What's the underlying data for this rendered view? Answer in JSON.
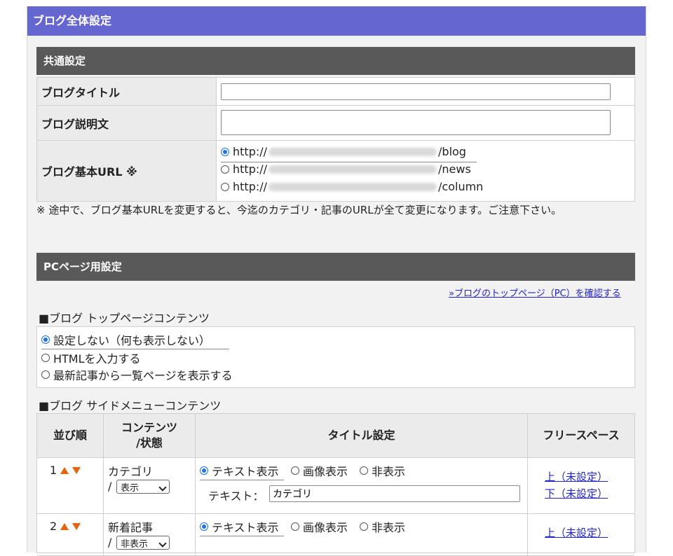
{
  "header": {
    "title": "ブログ全体設定"
  },
  "common": {
    "heading": "共通設定",
    "title_label": "ブログタイトル",
    "title_value": "",
    "description_label": "ブログ説明文",
    "description_value": "",
    "url_label": "ブログ基本URL ※",
    "url_options": [
      {
        "prefix": "http://",
        "suffix": "/blog",
        "selected": true
      },
      {
        "prefix": "http://",
        "suffix": "/news",
        "selected": false
      },
      {
        "prefix": "http://",
        "suffix": "/column",
        "selected": false
      }
    ],
    "note": "※ 途中で、ブログ基本URLを変更すると、今迄のカテゴリ・記事のURLが全て変更になります。ご注意下さい。"
  },
  "pc": {
    "heading": "PCページ用設定",
    "check_link": "»ブログのトップページ（PC）を確認する",
    "top_contents_title": "■ブログ トップページコンテンツ",
    "top_options": [
      {
        "label": "設定しない（何も表示しない）",
        "selected": true
      },
      {
        "label": "HTMLを入力する",
        "selected": false
      },
      {
        "label": "最新記事から一覧ページを表示する",
        "selected": false
      }
    ],
    "side_menu_title": "■ブログ サイドメニューコンテンツ",
    "columns": {
      "order": "並び順",
      "content": "コンテンツ\n/状態",
      "title": "タイトル設定",
      "free_space": "フリースペース"
    },
    "rows": [
      {
        "order": "1",
        "content": "カテゴリ",
        "status_prefix": "/",
        "status": "表示",
        "title_options": [
          "テキスト表示",
          "画像表示",
          "非表示"
        ],
        "text_label": "テキスト：",
        "text_value": "カテゴリ",
        "free_top": "上（未設定）",
        "free_bottom": "下（未設定）"
      },
      {
        "order": "2",
        "content": "新着記事",
        "status_prefix": "/",
        "status": "非表示",
        "title_options": [
          "テキスト表示",
          "画像表示",
          "非表示"
        ],
        "free_top": "上（未設定）"
      }
    ]
  },
  "colors": {
    "header_bg": "#6666d1",
    "section_bg": "#595959",
    "accent": "#e8620c",
    "link": "#2222cc"
  }
}
